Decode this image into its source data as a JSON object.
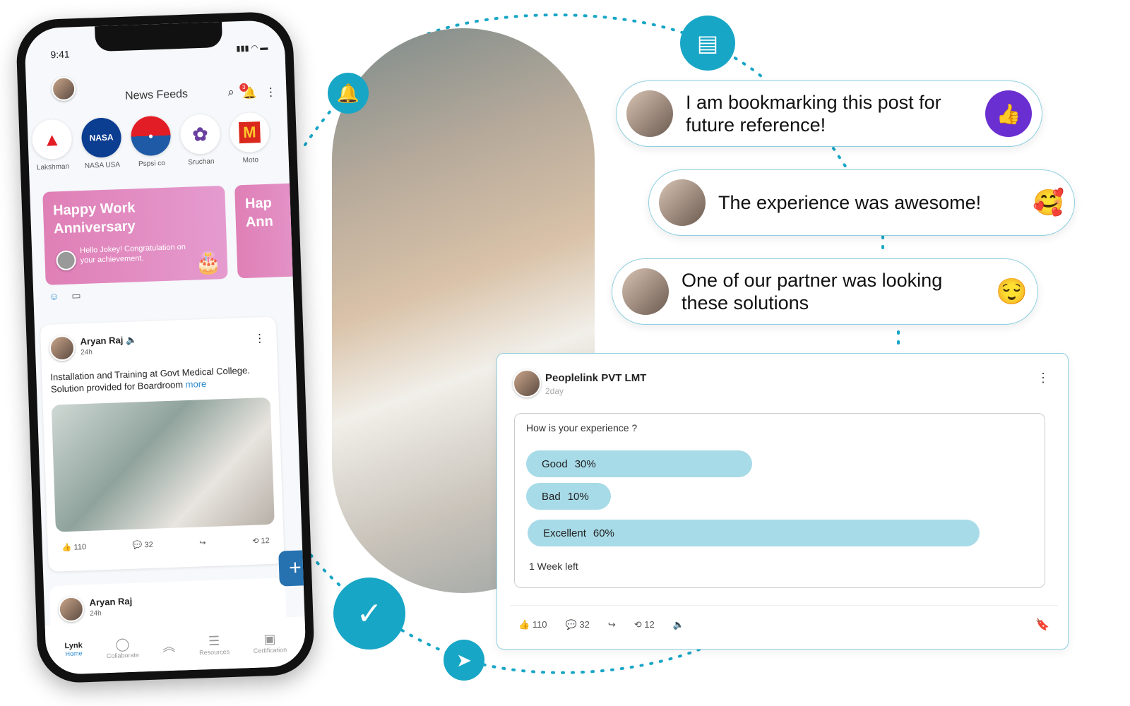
{
  "phone": {
    "status_time": "9:41",
    "header_title": "News Feeds",
    "notification_count": "3",
    "stories": [
      {
        "label": "Lakshman",
        "logo": "▲"
      },
      {
        "label": "NASA USA",
        "logo": "NASA"
      },
      {
        "label": "Pspsi co",
        "logo": "●"
      },
      {
        "label": "Sruchan",
        "logo": "✿"
      },
      {
        "label": "Moto",
        "logo": "M"
      }
    ],
    "anniversary_card": {
      "title": "Happy Work Anniversary",
      "message": "Hello Jokey! Congratulation on your achievement.",
      "partial_title": "Hap Ann"
    },
    "post": {
      "author": "Aryan Raj",
      "time": "24h",
      "text": "Installation and Training at Govt Medical College. Solution provided for Boardroom",
      "more_label": "more",
      "likes": "110",
      "comments": "32",
      "reposts": "12"
    },
    "post2": {
      "author": "Aryan Raj",
      "time": "24h"
    },
    "nav": {
      "logo_text": "Lynk",
      "items": [
        "Home",
        "Collaborate",
        "",
        "Resources",
        "Certification"
      ]
    }
  },
  "comments": [
    {
      "text": "I am bookmarking this post for future reference!",
      "reaction": "thumbs-up"
    },
    {
      "text": "The experience was awesome!",
      "reaction": "🥰"
    },
    {
      "text": "One of our partner was looking these solutions",
      "reaction": "😌"
    }
  ],
  "poll_post": {
    "author": "Peoplelink PVT LMT",
    "time": "2day",
    "question": "How is your experience ?",
    "options": [
      {
        "label": "Good",
        "percent": 30,
        "percent_label": "30%"
      },
      {
        "label": "Bad",
        "percent": 10,
        "percent_label": "10%"
      },
      {
        "label": "Excellent",
        "percent": 60,
        "percent_label": "60%"
      }
    ],
    "time_left": "1 Week left",
    "likes": "110",
    "comments": "32",
    "reposts": "12"
  },
  "colors": {
    "accent": "#18a6c6",
    "poll_bar": "#a8dbe8",
    "like_badge": "#6a2fd0",
    "fab": "#2672b0",
    "anniversary": "#df7fb6"
  }
}
